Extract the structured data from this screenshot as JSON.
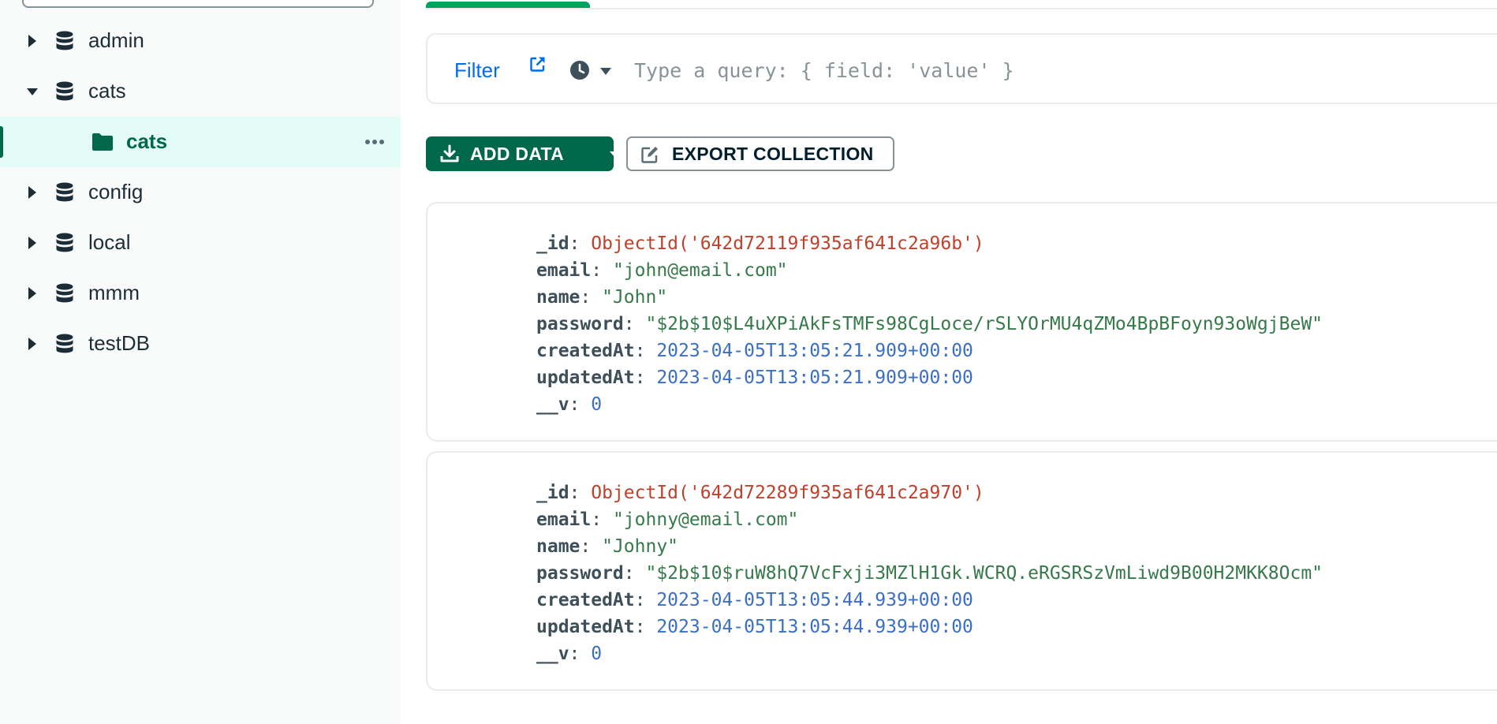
{
  "sidebar": {
    "databases": [
      {
        "name": "admin",
        "expanded": false
      },
      {
        "name": "cats",
        "expanded": true,
        "collections": [
          {
            "name": "cats",
            "active": true
          }
        ]
      },
      {
        "name": "config",
        "expanded": false
      },
      {
        "name": "local",
        "expanded": false
      },
      {
        "name": "mmm",
        "expanded": false
      },
      {
        "name": "testDB",
        "expanded": false
      }
    ]
  },
  "filter": {
    "label": "Filter",
    "placeholder": "Type a query: { field: 'value' }"
  },
  "toolbar": {
    "add_data_label": "ADD DATA",
    "export_label": "EXPORT COLLECTION"
  },
  "documents": [
    {
      "fields": [
        {
          "key": "_id",
          "value": "ObjectId('642d72119f935af641c2a96b')",
          "type": "oid"
        },
        {
          "key": "email",
          "value": "\"john@email.com\"",
          "type": "str"
        },
        {
          "key": "name",
          "value": "\"John\"",
          "type": "str"
        },
        {
          "key": "password",
          "value": "\"$2b$10$L4uXPiAkFsTMFs98CgLoce/rSLYOrMU4qZMo4BpBFoyn93oWgjBeW\"",
          "type": "str"
        },
        {
          "key": "createdAt",
          "value": "2023-04-05T13:05:21.909+00:00",
          "type": "date"
        },
        {
          "key": "updatedAt",
          "value": "2023-04-05T13:05:21.909+00:00",
          "type": "date"
        },
        {
          "key": "__v",
          "value": "0",
          "type": "num"
        }
      ]
    },
    {
      "fields": [
        {
          "key": "_id",
          "value": "ObjectId('642d72289f935af641c2a970')",
          "type": "oid"
        },
        {
          "key": "email",
          "value": "\"johny@email.com\"",
          "type": "str"
        },
        {
          "key": "name",
          "value": "\"Johny\"",
          "type": "str"
        },
        {
          "key": "password",
          "value": "\"$2b$10$ruW8hQ7VcFxji3MZlH1Gk.WCRQ.eRGSRSzVmLiwd9B00H2MKK8Ocm\"",
          "type": "str"
        },
        {
          "key": "createdAt",
          "value": "2023-04-05T13:05:44.939+00:00",
          "type": "date"
        },
        {
          "key": "updatedAt",
          "value": "2023-04-05T13:05:44.939+00:00",
          "type": "date"
        },
        {
          "key": "__v",
          "value": "0",
          "type": "num"
        }
      ]
    }
  ],
  "colors": {
    "accent_green": "#00684a",
    "tab_indicator": "#00a35c",
    "link_blue": "#016bf8",
    "objectid_red": "#c0412b",
    "string_green": "#367a4a",
    "date_blue": "#3a6fc4"
  },
  "icons": {
    "caret_collapsed": "caret-right-icon",
    "caret_expanded": "caret-down-icon",
    "database": "database-icon",
    "folder": "folder-icon",
    "more": "ellipsis-icon",
    "external": "external-link-icon",
    "history": "clock-icon",
    "download": "download-icon",
    "export": "edit-icon"
  }
}
